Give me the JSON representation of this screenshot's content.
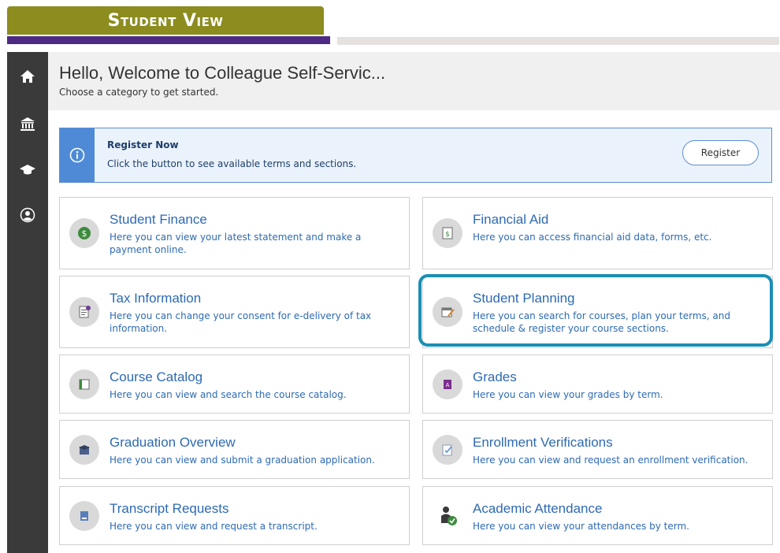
{
  "banner": {
    "label": "Student View"
  },
  "sidebar": {
    "items": [
      {
        "icon": "home-icon"
      },
      {
        "icon": "institution-icon"
      },
      {
        "icon": "graduation-cap-icon"
      },
      {
        "icon": "user-icon"
      }
    ]
  },
  "header": {
    "title": "Hello, Welcome to Colleague Self-Servic...",
    "subtitle": "Choose a category to get started."
  },
  "alert": {
    "title": "Register Now",
    "text": "Click the button to see available terms and sections.",
    "button_label": "Register"
  },
  "cards": [
    {
      "title": "Student Finance",
      "desc": "Here you can view your latest statement and make a payment online.",
      "icon": "dollar-icon"
    },
    {
      "title": "Financial Aid",
      "desc": "Here you can access financial aid data, forms, etc.",
      "icon": "financial-aid-icon"
    },
    {
      "title": "Tax Information",
      "desc": "Here you can change your consent for e-delivery of tax information.",
      "icon": "tax-form-icon"
    },
    {
      "title": "Student Planning",
      "desc": "Here you can search for courses, plan your terms, and schedule & register your course sections.",
      "icon": "calendar-planning-icon"
    },
    {
      "title": "Course Catalog",
      "desc": "Here you can view and search the course catalog.",
      "icon": "book-icon"
    },
    {
      "title": "Grades",
      "desc": "Here you can view your grades by term.",
      "icon": "grade-icon"
    },
    {
      "title": "Graduation Overview",
      "desc": "Here you can view and submit a graduation application.",
      "icon": "graduation-icon"
    },
    {
      "title": "Enrollment Verifications",
      "desc": "Here you can view and request an enrollment verification.",
      "icon": "verification-icon"
    },
    {
      "title": "Transcript Requests",
      "desc": "Here you can view and request a transcript.",
      "icon": "transcript-icon"
    },
    {
      "title": "Academic Attendance",
      "desc": "Here you can view your attendances by term.",
      "icon": "attendance-icon"
    }
  ],
  "colors": {
    "banner": "#8c8c1f",
    "purple_bar": "#4e2a84",
    "sidebar": "#3a3a3a",
    "link": "#2d6ab2",
    "alert_accent": "#4e8ad6",
    "highlight": "#1a8fb5"
  }
}
